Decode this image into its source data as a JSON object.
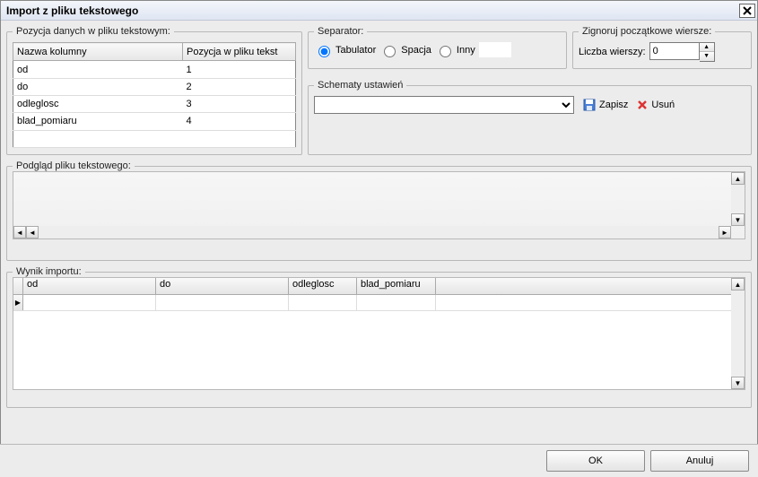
{
  "title": "Import z pliku tekstowego",
  "position_group": {
    "legend": "Pozycja danych w pliku tekstowym:",
    "headers": {
      "col1": "Nazwa kolumny",
      "col2": "Pozycja w pliku tekst"
    },
    "rows": [
      {
        "name": "od",
        "pos": "1"
      },
      {
        "name": "do",
        "pos": "2"
      },
      {
        "name": "odleglosc",
        "pos": "3"
      },
      {
        "name": "blad_pomiaru",
        "pos": "4"
      }
    ]
  },
  "separator_group": {
    "legend": "Separator:",
    "options": {
      "tab": "Tabulator",
      "space": "Spacja",
      "other": "Inny"
    },
    "selected": "tab",
    "other_value": ""
  },
  "skip_group": {
    "legend": "Zignoruj początkowe wiersze:",
    "label": "Liczba wierszy:",
    "value": "0"
  },
  "schemes_group": {
    "legend": "Schematy ustawień",
    "selected": "",
    "save_label": "Zapisz",
    "delete_label": "Usuń"
  },
  "preview_group": {
    "legend": "Podgląd pliku tekstowego:"
  },
  "result_group": {
    "legend": "Wynik importu:",
    "columns": [
      "od",
      "do",
      "odleglosc",
      "blad_pomiaru"
    ]
  },
  "buttons": {
    "ok": "OK",
    "cancel": "Anuluj"
  }
}
